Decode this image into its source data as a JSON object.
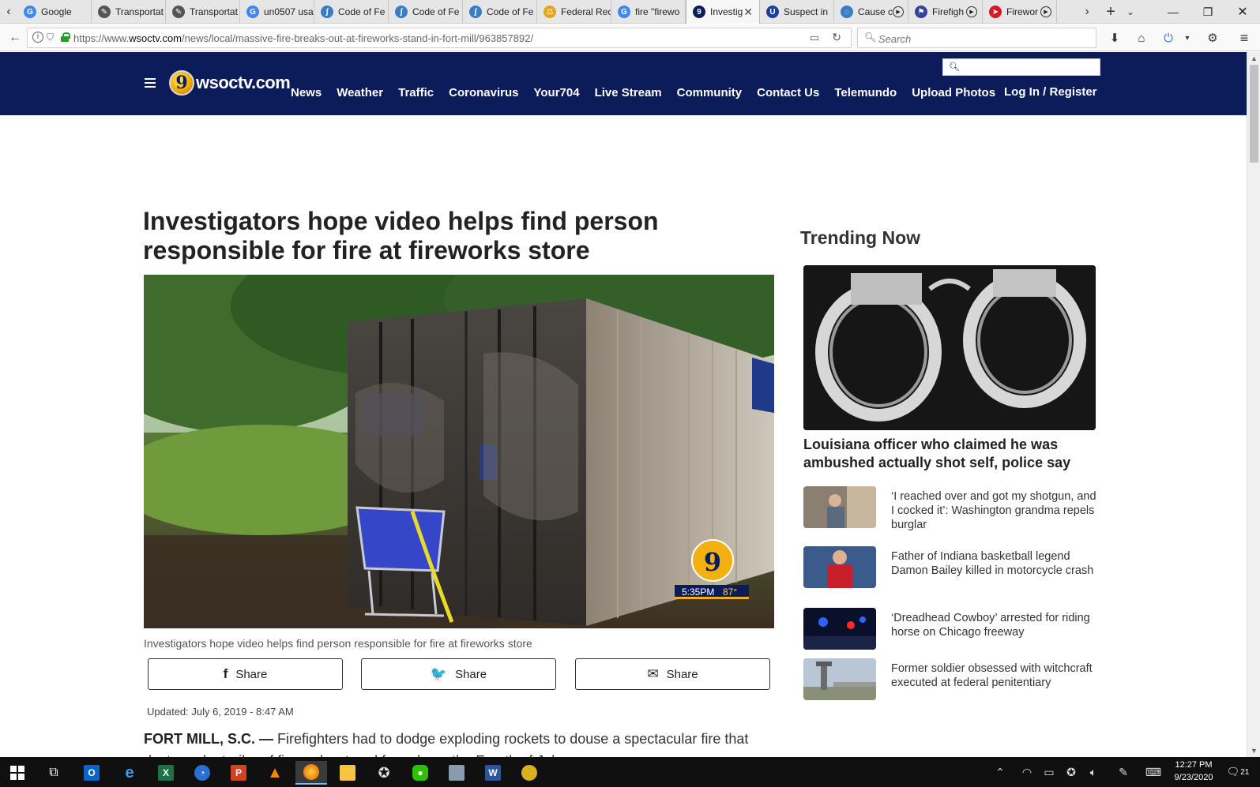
{
  "browser": {
    "tabs": [
      {
        "label": "Google",
        "icon": "google-icon",
        "color": "#4285f4"
      },
      {
        "label": "Transportat",
        "icon": "doc-icon",
        "color": "#555555"
      },
      {
        "label": "Transportat",
        "icon": "doc-icon",
        "color": "#555555"
      },
      {
        "label": "un0507 usa",
        "icon": "google-icon",
        "color": "#4285f4"
      },
      {
        "label": "Code of Fe",
        "icon": "ecfr-icon",
        "color": "#3b7dc4"
      },
      {
        "label": "Code of Fe",
        "icon": "ecfr-icon",
        "color": "#3b7dc4"
      },
      {
        "label": "Code of Fe",
        "icon": "ecfr-icon",
        "color": "#3b7dc4"
      },
      {
        "label": "Federal Rec",
        "icon": "fedreg-icon",
        "color": "#e8a317"
      },
      {
        "label": "fire \"firewo",
        "icon": "google-icon",
        "color": "#4285f4"
      },
      {
        "label": "Investig",
        "icon": "wsoc-icon",
        "color": "#0c1c5a",
        "active": true
      },
      {
        "label": "Suspect in",
        "icon": "ul-icon",
        "color": "#1a3fa0"
      },
      {
        "label": "Cause c",
        "icon": "loading-icon",
        "color": "#3b7dc4"
      },
      {
        "label": "Firefigh",
        "icon": "firefighter-icon",
        "color": "#334499"
      },
      {
        "label": "Firewor",
        "icon": "news-icon",
        "color": "#d11a2a"
      }
    ],
    "url_prefix": "https://www.",
    "url_domain": "wsoctv.com",
    "url_path": "/news/local/massive-fire-breaks-out-at-fireworks-stand-in-fort-mill/963857892/",
    "search_placeholder": "Search"
  },
  "site": {
    "logo_number": "9",
    "logo_text": "wsoctv.com",
    "nav": [
      "News",
      "Weather",
      "Traffic",
      "Coronavirus",
      "Your704",
      "Live Stream",
      "Community",
      "Contact Us",
      "Telemundo",
      "Upload Photos"
    ],
    "login": "Log In / Register"
  },
  "article": {
    "headline": "Investigators hope video helps find person responsible for fire at fireworks store",
    "caption": "Investigators hope video helps find person responsible for fire at fireworks store",
    "hero_overlay": {
      "logo": "9",
      "time": "5:35PM",
      "temp": "87°"
    },
    "share": [
      {
        "icon": "facebook-icon",
        "glyph": "f",
        "label": "Share"
      },
      {
        "icon": "twitter-icon",
        "glyph": "🐦",
        "label": "Share"
      },
      {
        "icon": "email-icon",
        "glyph": "✉",
        "label": "Share"
      }
    ],
    "updated": "Updated: July 6, 2019 - 8:47 AM",
    "dateline": "FORT MILL, S.C. —",
    "lede": " Firefighters had to dodge exploding rockets to douse a spectacular fire that destroyed a trailer of fireworks stored for sale on the Fourth of July."
  },
  "trending": {
    "title": "Trending Now",
    "hero_title": "Louisiana officer who claimed he was ambushed actually shot self, police say",
    "items": [
      {
        "title": "‘I reached over and got my shotgun, and I cocked it’: Washington grandma repels burglar"
      },
      {
        "title": "Father of Indiana basketball legend Damon Bailey killed in motorcycle crash"
      },
      {
        "title": "‘Dreadhead Cowboy’ arrested for riding horse on Chicago freeway"
      },
      {
        "title": "Former soldier obsessed with witchcraft executed at federal penitentiary"
      }
    ]
  },
  "taskbar": {
    "time": "12:27 PM",
    "date": "9/23/2020",
    "notifications": "21"
  }
}
